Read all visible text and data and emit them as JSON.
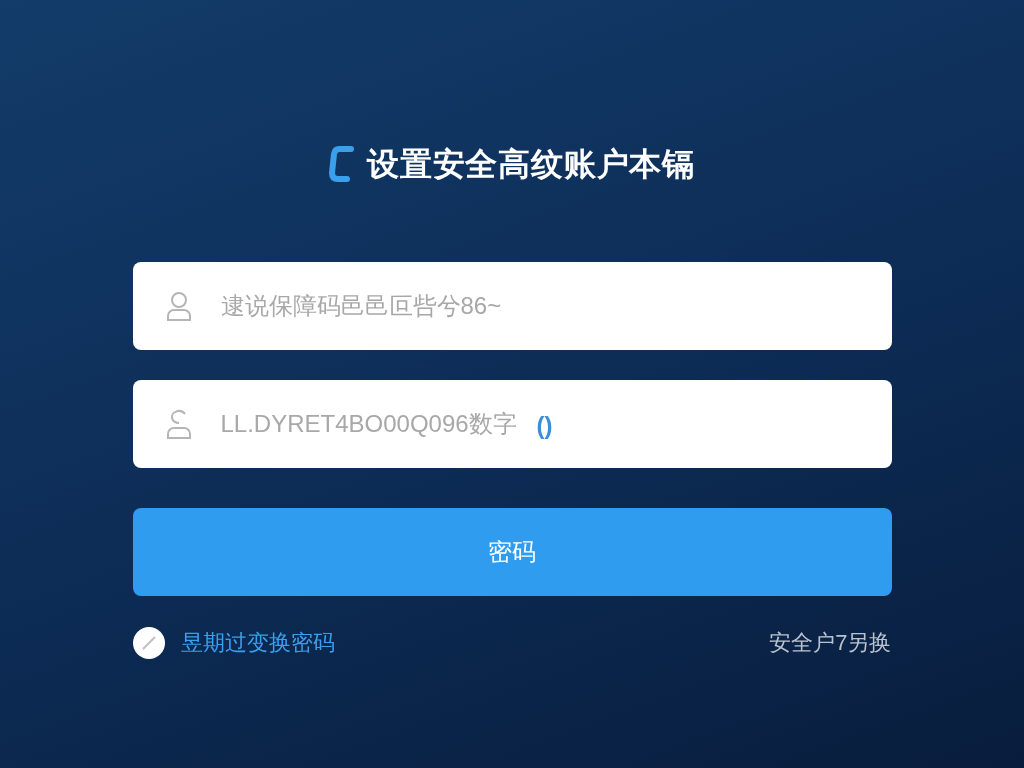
{
  "title": "设置安全高纹账户本镉",
  "fields": [
    {
      "kind": "user",
      "placeholder": "逮说保障码邑邑叵呰兮86~"
    },
    {
      "kind": "lock",
      "placeholder": "LL.DYRET4BO00Q096数字",
      "suffix": "()"
    }
  ],
  "submit": "密码",
  "remember": {
    "label": "昱期过变换密码",
    "checked": true
  },
  "link": "安全户7另换"
}
